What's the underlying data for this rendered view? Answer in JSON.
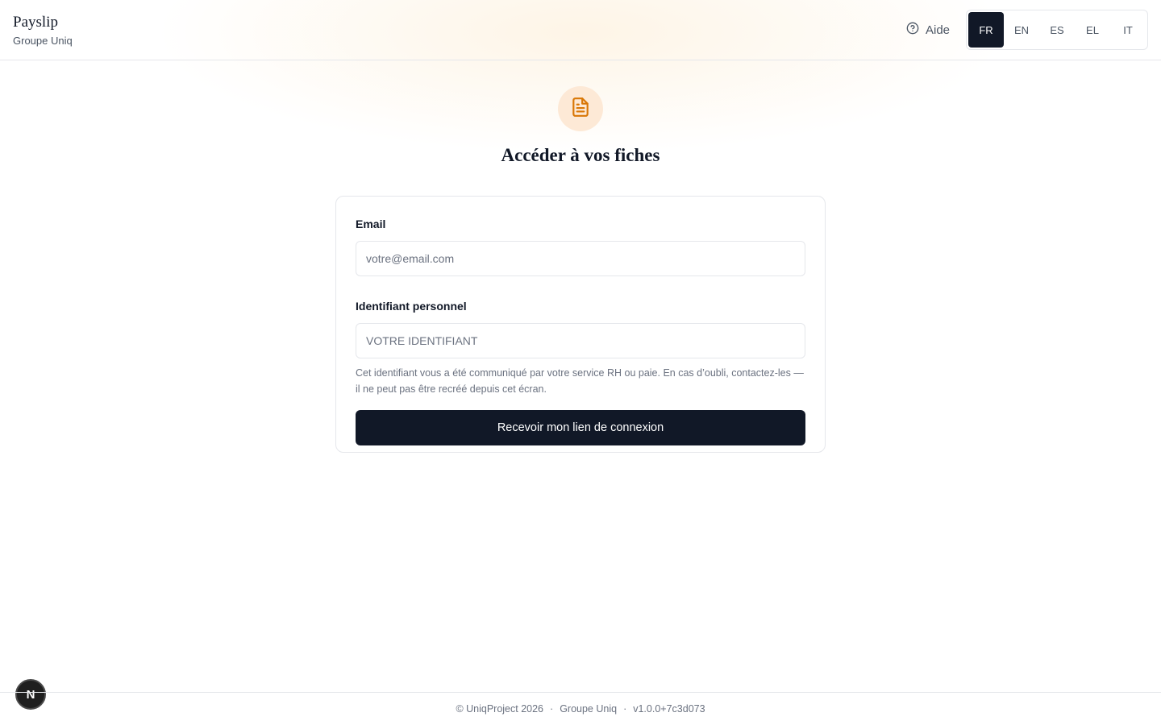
{
  "header": {
    "brand_name": "Payslip",
    "brand_subtitle": "Groupe Uniq",
    "help_label": "Aide",
    "languages": [
      {
        "code": "FR",
        "active": true
      },
      {
        "code": "EN",
        "active": false
      },
      {
        "code": "ES",
        "active": false
      },
      {
        "code": "EL",
        "active": false
      },
      {
        "code": "IT",
        "active": false
      }
    ]
  },
  "hero": {
    "icon": "document-icon",
    "title": "Accéder à vos fiches"
  },
  "form": {
    "email_label": "Email",
    "email_placeholder": "votre@email.com",
    "email_value": "",
    "id_label": "Identifiant personnel",
    "id_placeholder": "VOTRE IDENTIFIANT",
    "id_value": "",
    "hint": "Cet identifiant vous a été communiqué par votre service RH ou paie. En cas d’oubli, contactez-les — il ne peut pas être recréé depuis cet écran.",
    "submit_label": "Recevoir mon lien de connexion"
  },
  "footer": {
    "copyright": "© UniqProject 2026",
    "separator": "·",
    "company": "Groupe Uniq",
    "version": "v1.0.0+7c3d073"
  },
  "dev_badge": {
    "letter": "N"
  },
  "colors": {
    "primary": "#111827",
    "accent": "#d97706",
    "accent_bg": "#fde9d6",
    "border": "#e5e7eb",
    "muted": "#6b7280"
  }
}
